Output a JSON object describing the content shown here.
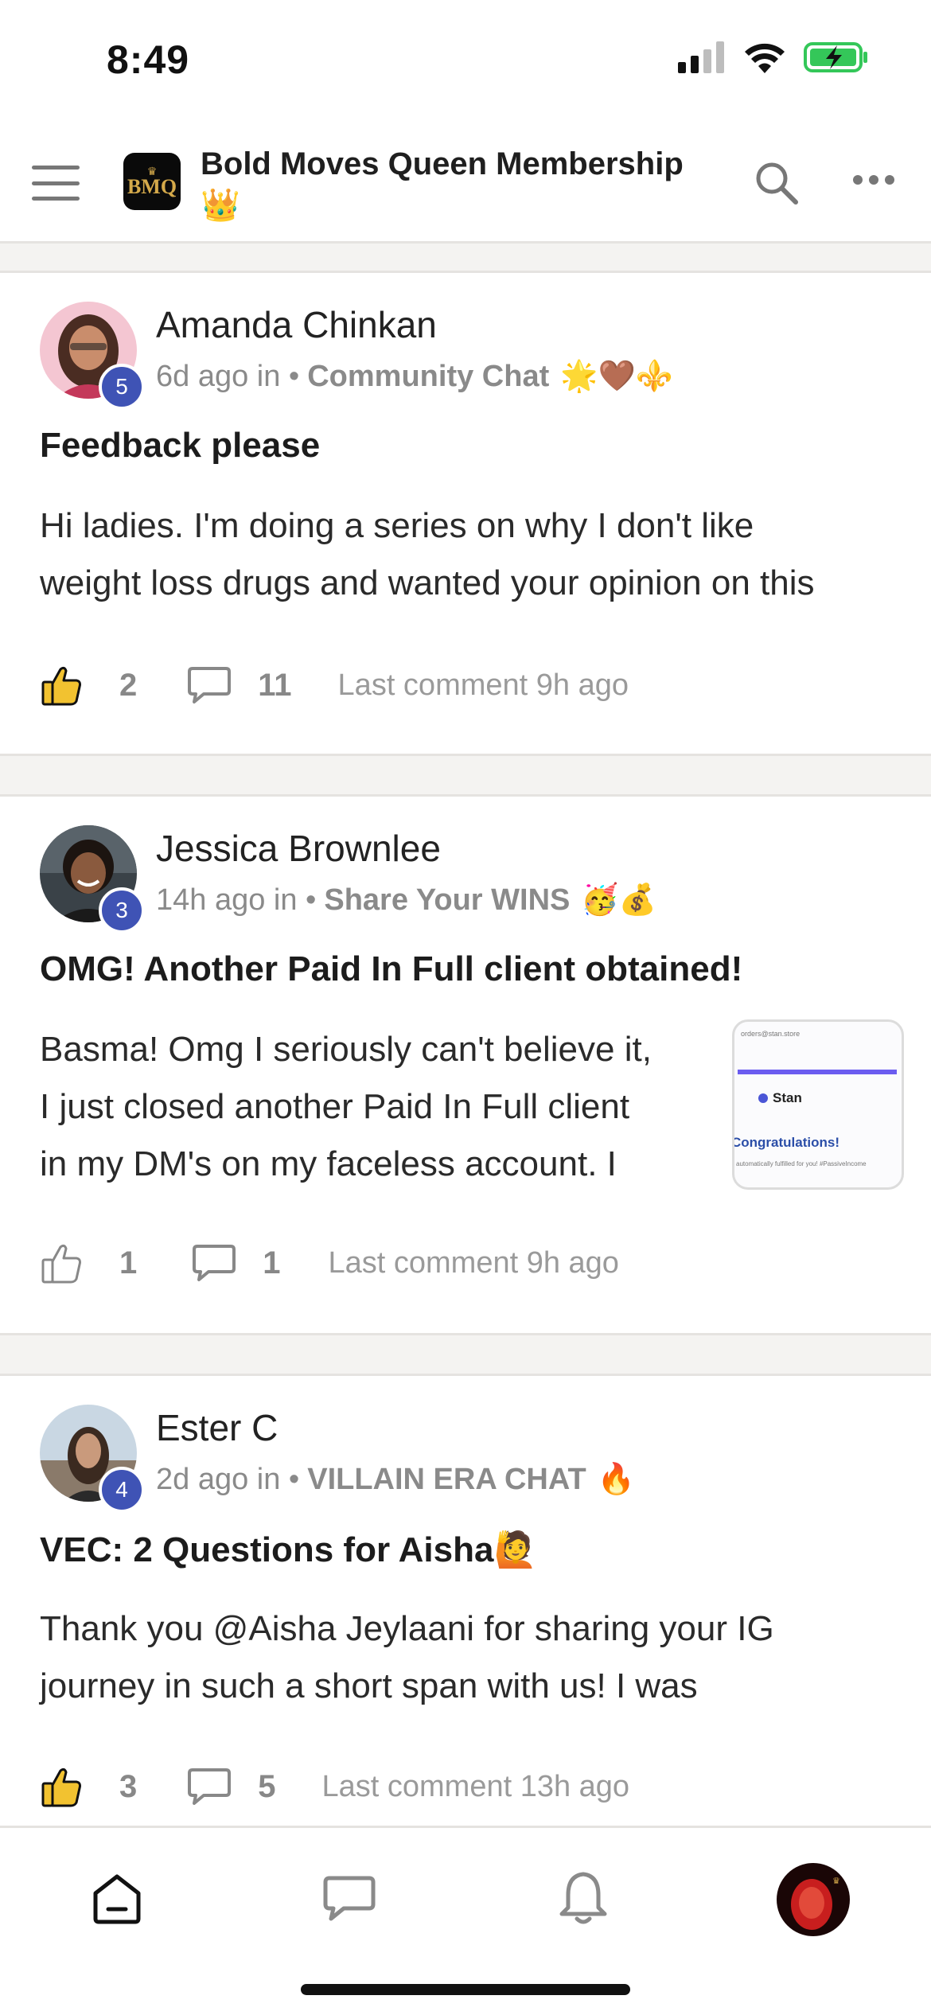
{
  "status_bar": {
    "time": "8:49"
  },
  "header": {
    "logo_letters": "BMQ",
    "group_name": "Bold Moves Queen Membership",
    "group_emoji": "👑"
  },
  "posts": [
    {
      "author": "Amanda Chinkan",
      "level": "5",
      "time_prefix": "6d ago in •",
      "category": "Community Chat",
      "category_emoji": "🌟🤎⚜️",
      "title": "Feedback please",
      "body_lines": [
        "Hi ladies. I'm doing a series on why I don't like",
        "weight loss drugs and wanted your opinion on this"
      ],
      "likes": "2",
      "comments": "11",
      "last_comment": "Last comment 9h ago",
      "liked": true
    },
    {
      "author": "Jessica Brownlee",
      "level": "3",
      "time_prefix": "14h ago in •",
      "category": "Share Your WINS",
      "category_emoji": "🥳💰",
      "title": "OMG! Another Paid In Full client obtained!",
      "body_lines": [
        "Basma! Omg I seriously can't believe it,",
        "I just closed another Paid In Full client",
        "in my DM's on my faceless account. I"
      ],
      "likes": "1",
      "comments": "1",
      "last_comment": "Last comment 9h ago",
      "liked": false,
      "thumbnail": {
        "email": "orders@stan.store",
        "brand": "Stan",
        "headline": "Congratulations!",
        "small_text": "automatically fulfilled for you! #PassiveIncome"
      }
    },
    {
      "author": "Ester C",
      "level": "4",
      "time_prefix": "2d ago in •",
      "category": "VILLAIN ERA CHAT",
      "category_emoji": "🔥",
      "title": "VEC: 2 Questions for Aisha🙋",
      "body_lines": [
        "Thank you @Aisha Jeylaani for sharing your IG",
        "journey in such a short span with us! I was"
      ],
      "likes": "3",
      "comments": "5",
      "last_comment": "Last comment 13h ago",
      "liked": true
    }
  ],
  "icons": {
    "home": "home-icon",
    "chat": "chat-icon",
    "notifications": "bell-icon",
    "profile": "profile-avatar"
  },
  "colors": {
    "badge": "#3f53b5",
    "like_active": "#f2c230",
    "battery": "#34c759"
  }
}
